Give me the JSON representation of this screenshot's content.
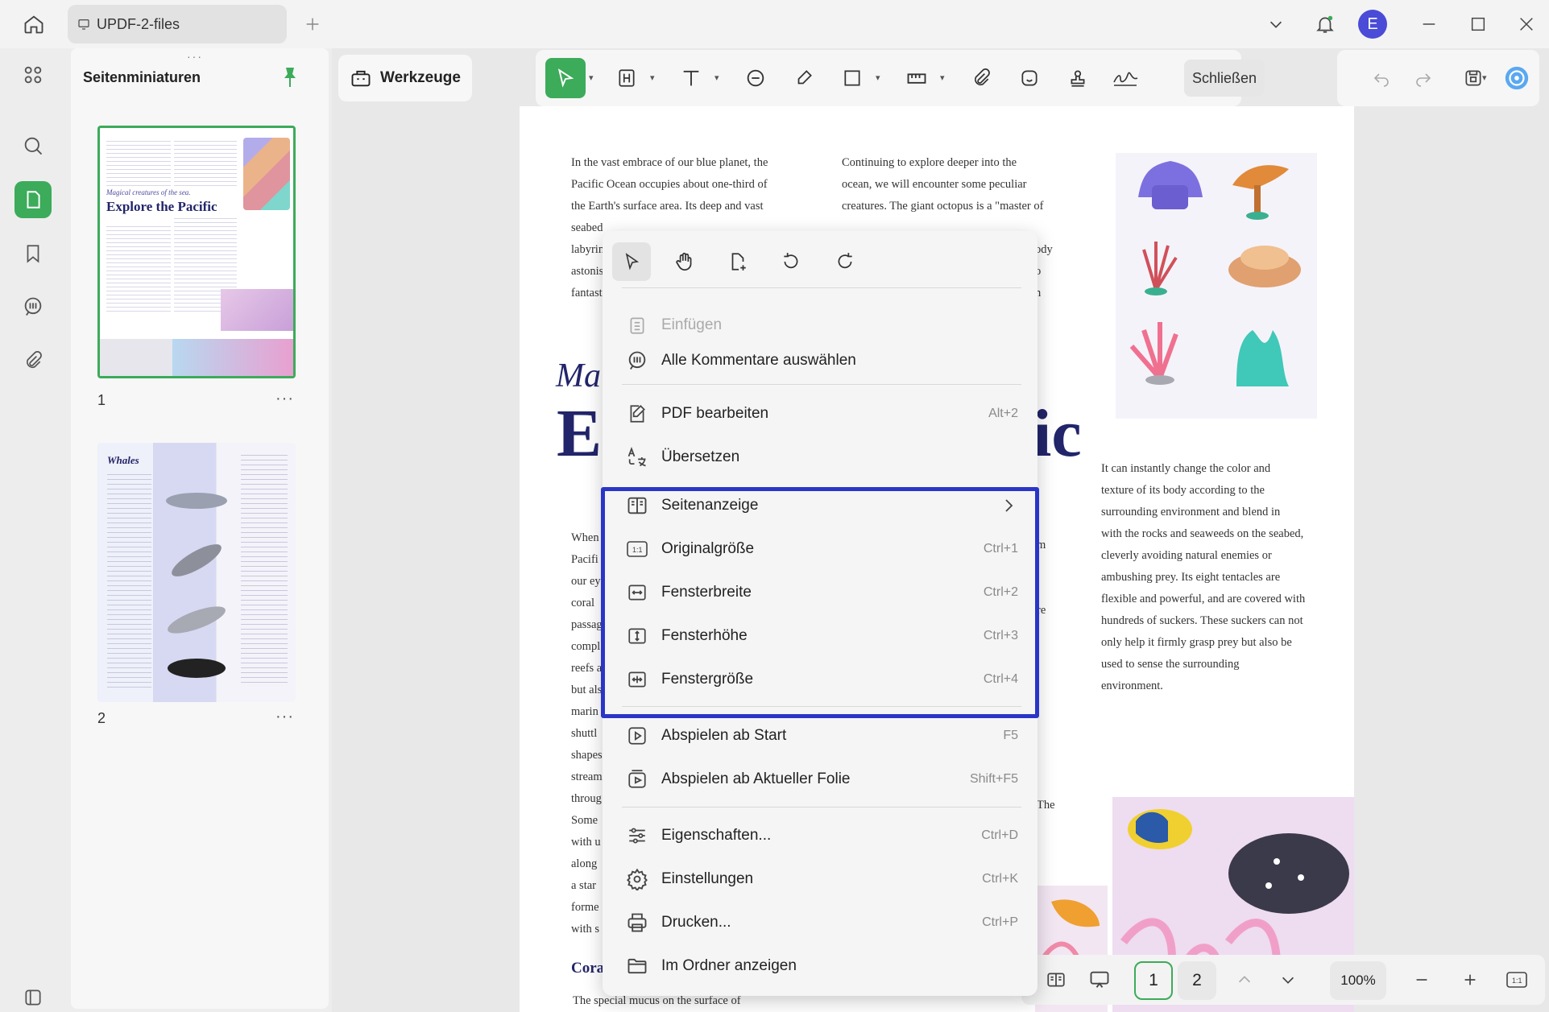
{
  "titlebar": {
    "tab_title": "UPDF-2-files",
    "avatar_letter": "E",
    "avatar_color": "#4a4bd6"
  },
  "sidebar": {
    "title": "Seitenminiaturen",
    "pages": [
      "1",
      "2"
    ],
    "more": "···"
  },
  "toolbar": {
    "tools_label": "Werkzeuge",
    "close_label": "Schließen",
    "accent": "#3cab5a"
  },
  "thumb1": {
    "subtitle": "Magical creatures of the sea.",
    "title": "Explore the Pacific"
  },
  "thumb2": {
    "title": "Whales"
  },
  "page": {
    "col1": [
      "In the vast embrace of our blue planet, the",
      "Pacific Ocean occupies about one-third of",
      "the Earth's surface area. Its deep and vast",
      "seabed",
      "labyrin",
      "astonis",
      "fantast"
    ],
    "col2": [
      "Continuing to explore deeper into the",
      "ocean, we will encounter some peculiar",
      "creatures. The giant octopus is a \"master of"
    ],
    "col2_frag": [
      "ody",
      "o",
      "n"
    ],
    "heading_italic": "Ma",
    "heading_big_left": "E",
    "heading_big_right": "ic",
    "col3": [
      "It can instantly change the color and",
      "texture of its body according to the",
      "surrounding environment and blend in",
      "with the rocks and seaweeds on the seabed,",
      "cleverly avoiding natural enemies or",
      "ambushing prey. Its eight tentacles are",
      "flexible and powerful, and are covered with",
      "hundreds of suckers. These suckers can not",
      "only help it firmly grasp prey but also be",
      "used to sense the surrounding",
      "environment."
    ],
    "col1b": [
      "When",
      "Pacifi",
      "our ey",
      "coral",
      "passag",
      "compl",
      "reefs a",
      "but als",
      "marin",
      "shuttl",
      "shapes",
      "stream",
      "throug",
      "Some",
      "with u",
      "along",
      "a star",
      "forme",
      "with s"
    ],
    "col2b_frag": [
      "m",
      "re"
    ],
    "the_frag": "The",
    "section": "Cora",
    "bottom_line": "The special mucus on the surface of"
  },
  "menu": {
    "items": [
      {
        "label": "Einfügen",
        "shortcut": ""
      },
      {
        "label": "Alle Kommentare auswählen",
        "shortcut": ""
      },
      {
        "label": "PDF bearbeiten",
        "shortcut": "Alt+2"
      },
      {
        "label": "Übersetzen",
        "shortcut": ""
      },
      {
        "label": "Seitenanzeige",
        "shortcut": ""
      },
      {
        "label": "Originalgröße",
        "shortcut": "Ctrl+1"
      },
      {
        "label": "Fensterbreite",
        "shortcut": "Ctrl+2"
      },
      {
        "label": "Fensterhöhe",
        "shortcut": "Ctrl+3"
      },
      {
        "label": "Fenstergröße",
        "shortcut": "Ctrl+4"
      },
      {
        "label": "Abspielen ab Start",
        "shortcut": "F5"
      },
      {
        "label": "Abspielen ab Aktueller Folie",
        "shortcut": "Shift+F5"
      },
      {
        "label": "Eigenschaften...",
        "shortcut": "Ctrl+D"
      },
      {
        "label": "Einstellungen",
        "shortcut": "Ctrl+K"
      },
      {
        "label": "Drucken...",
        "shortcut": "Ctrl+P"
      },
      {
        "label": "Im Ordner anzeigen",
        "shortcut": ""
      }
    ],
    "highlight_color": "#2a35c8"
  },
  "bottombar": {
    "pages": [
      "1",
      "2"
    ],
    "zoom": "100%"
  }
}
